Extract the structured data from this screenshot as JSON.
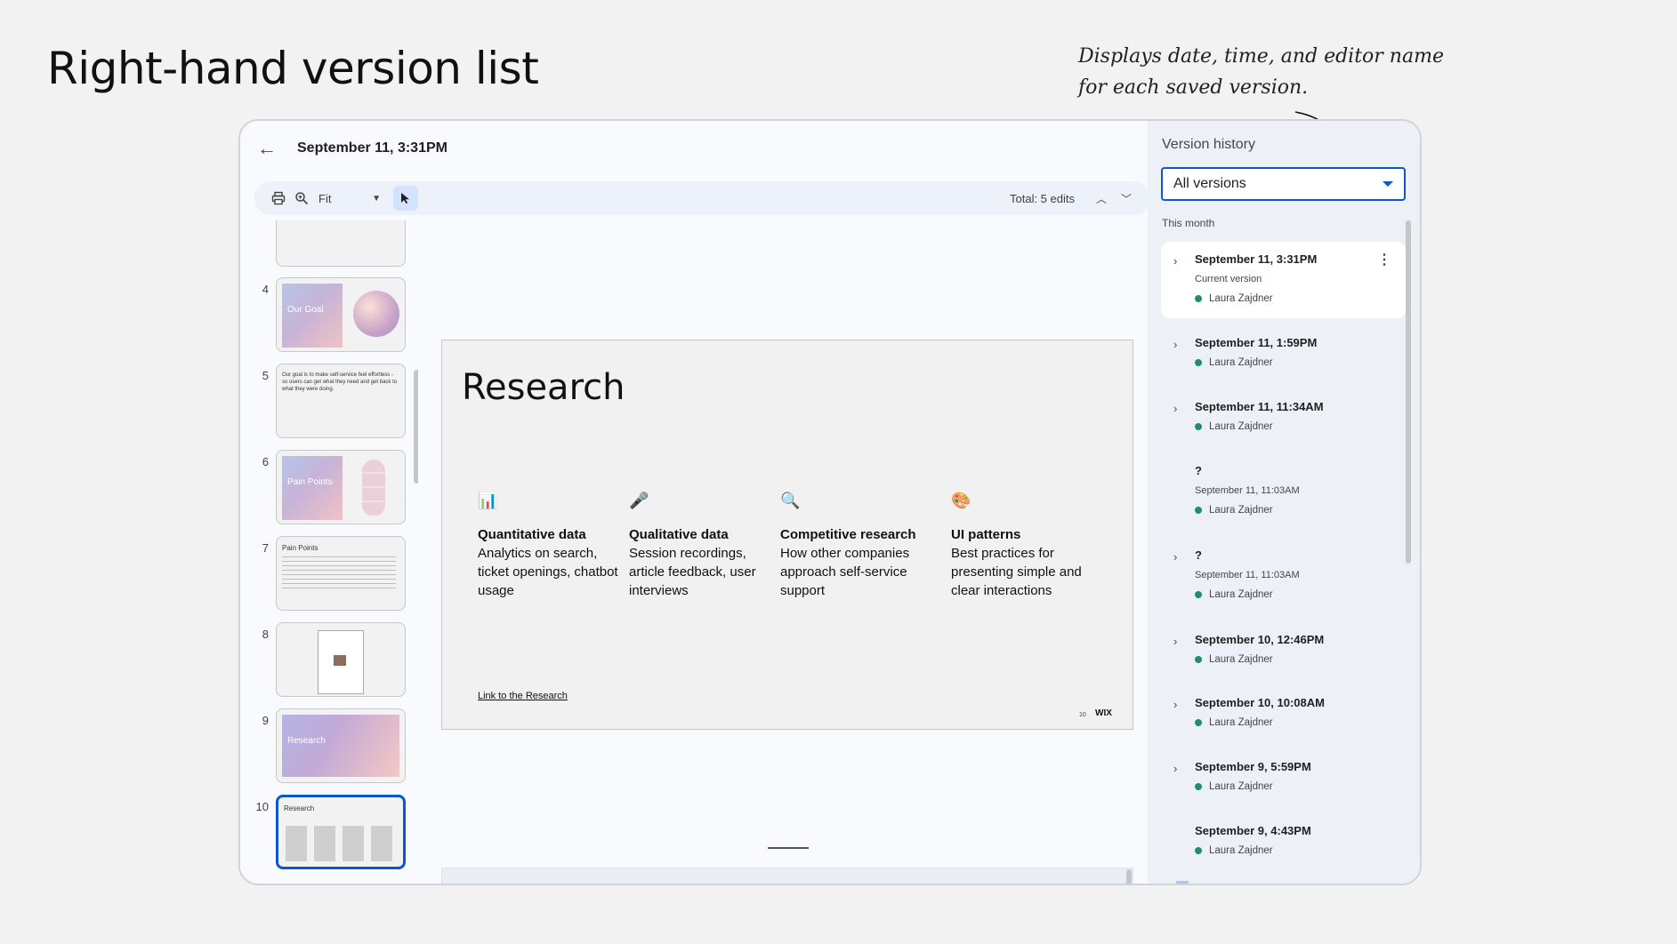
{
  "page": {
    "title": "Right-hand version list",
    "annotation_line1": "Displays date, time, and editor name",
    "annotation_line2": "for each saved version."
  },
  "header": {
    "back_icon": "arrow-left-icon",
    "doc_title": "September 11, 3:31PM"
  },
  "toolbar": {
    "print_icon": "printer-icon",
    "zoom_icon": "zoom-icon",
    "zoom_value": "Fit",
    "select_icon": "cursor-icon",
    "total_edits": "Total: 5 edits",
    "up_icon": "chevron-up-icon",
    "down_icon": "chevron-down-icon"
  },
  "thumbnails": [
    {
      "num": "4",
      "label": "Our Goal"
    },
    {
      "num": "5",
      "text": "Our goal is to make self-service feel effortless - so users can get what they need and get back to what they were doing."
    },
    {
      "num": "6",
      "label": "Pain Points"
    },
    {
      "num": "7",
      "label": "Pain Points"
    },
    {
      "num": "8"
    },
    {
      "num": "9",
      "label": "Research"
    },
    {
      "num": "10",
      "label": "Research"
    }
  ],
  "slide": {
    "title": "Research",
    "columns": [
      {
        "icon": "📊",
        "heading": "Quantitative data",
        "body": "Analytics on search, ticket openings, chatbot usage"
      },
      {
        "icon": "🎤",
        "heading": "Qualitative data",
        "body": "Session recordings, article feedback, user interviews"
      },
      {
        "icon": "🔍",
        "heading": "Competitive research",
        "body": "How other companies approach self-service support"
      },
      {
        "icon": "🎨",
        "heading": "UI patterns",
        "body": " Best practices for presenting simple and clear interactions"
      }
    ],
    "link": "Link to the Research",
    "page_number": "10",
    "logo": "WIX"
  },
  "history": {
    "title": "Version history",
    "filter_value": "All versions",
    "section": "This month",
    "versions": [
      {
        "date": "September 11, 3:31PM",
        "sub": "Current version",
        "editor": "Laura Zajdner"
      },
      {
        "date": "September 11, 1:59PM",
        "editor": "Laura Zajdner"
      },
      {
        "date": "September 11, 11:34AM",
        "editor": "Laura Zajdner"
      },
      {
        "date": "?",
        "sub": "September 11, 11:03AM",
        "editor": "Laura Zajdner"
      },
      {
        "date": "?",
        "sub": "September 11, 11:03AM",
        "editor": "Laura Zajdner"
      },
      {
        "date": "September 10, 12:46PM",
        "editor": "Laura Zajdner"
      },
      {
        "date": "September 10, 10:08AM",
        "editor": "Laura Zajdner"
      },
      {
        "date": "September 9, 5:59PM",
        "editor": "Laura Zajdner"
      },
      {
        "date": "September 9, 4:43PM",
        "editor": "Laura Zajdner"
      }
    ]
  },
  "colors": {
    "accent": "#0b57d0",
    "editor_dot": "#1e8e70"
  }
}
